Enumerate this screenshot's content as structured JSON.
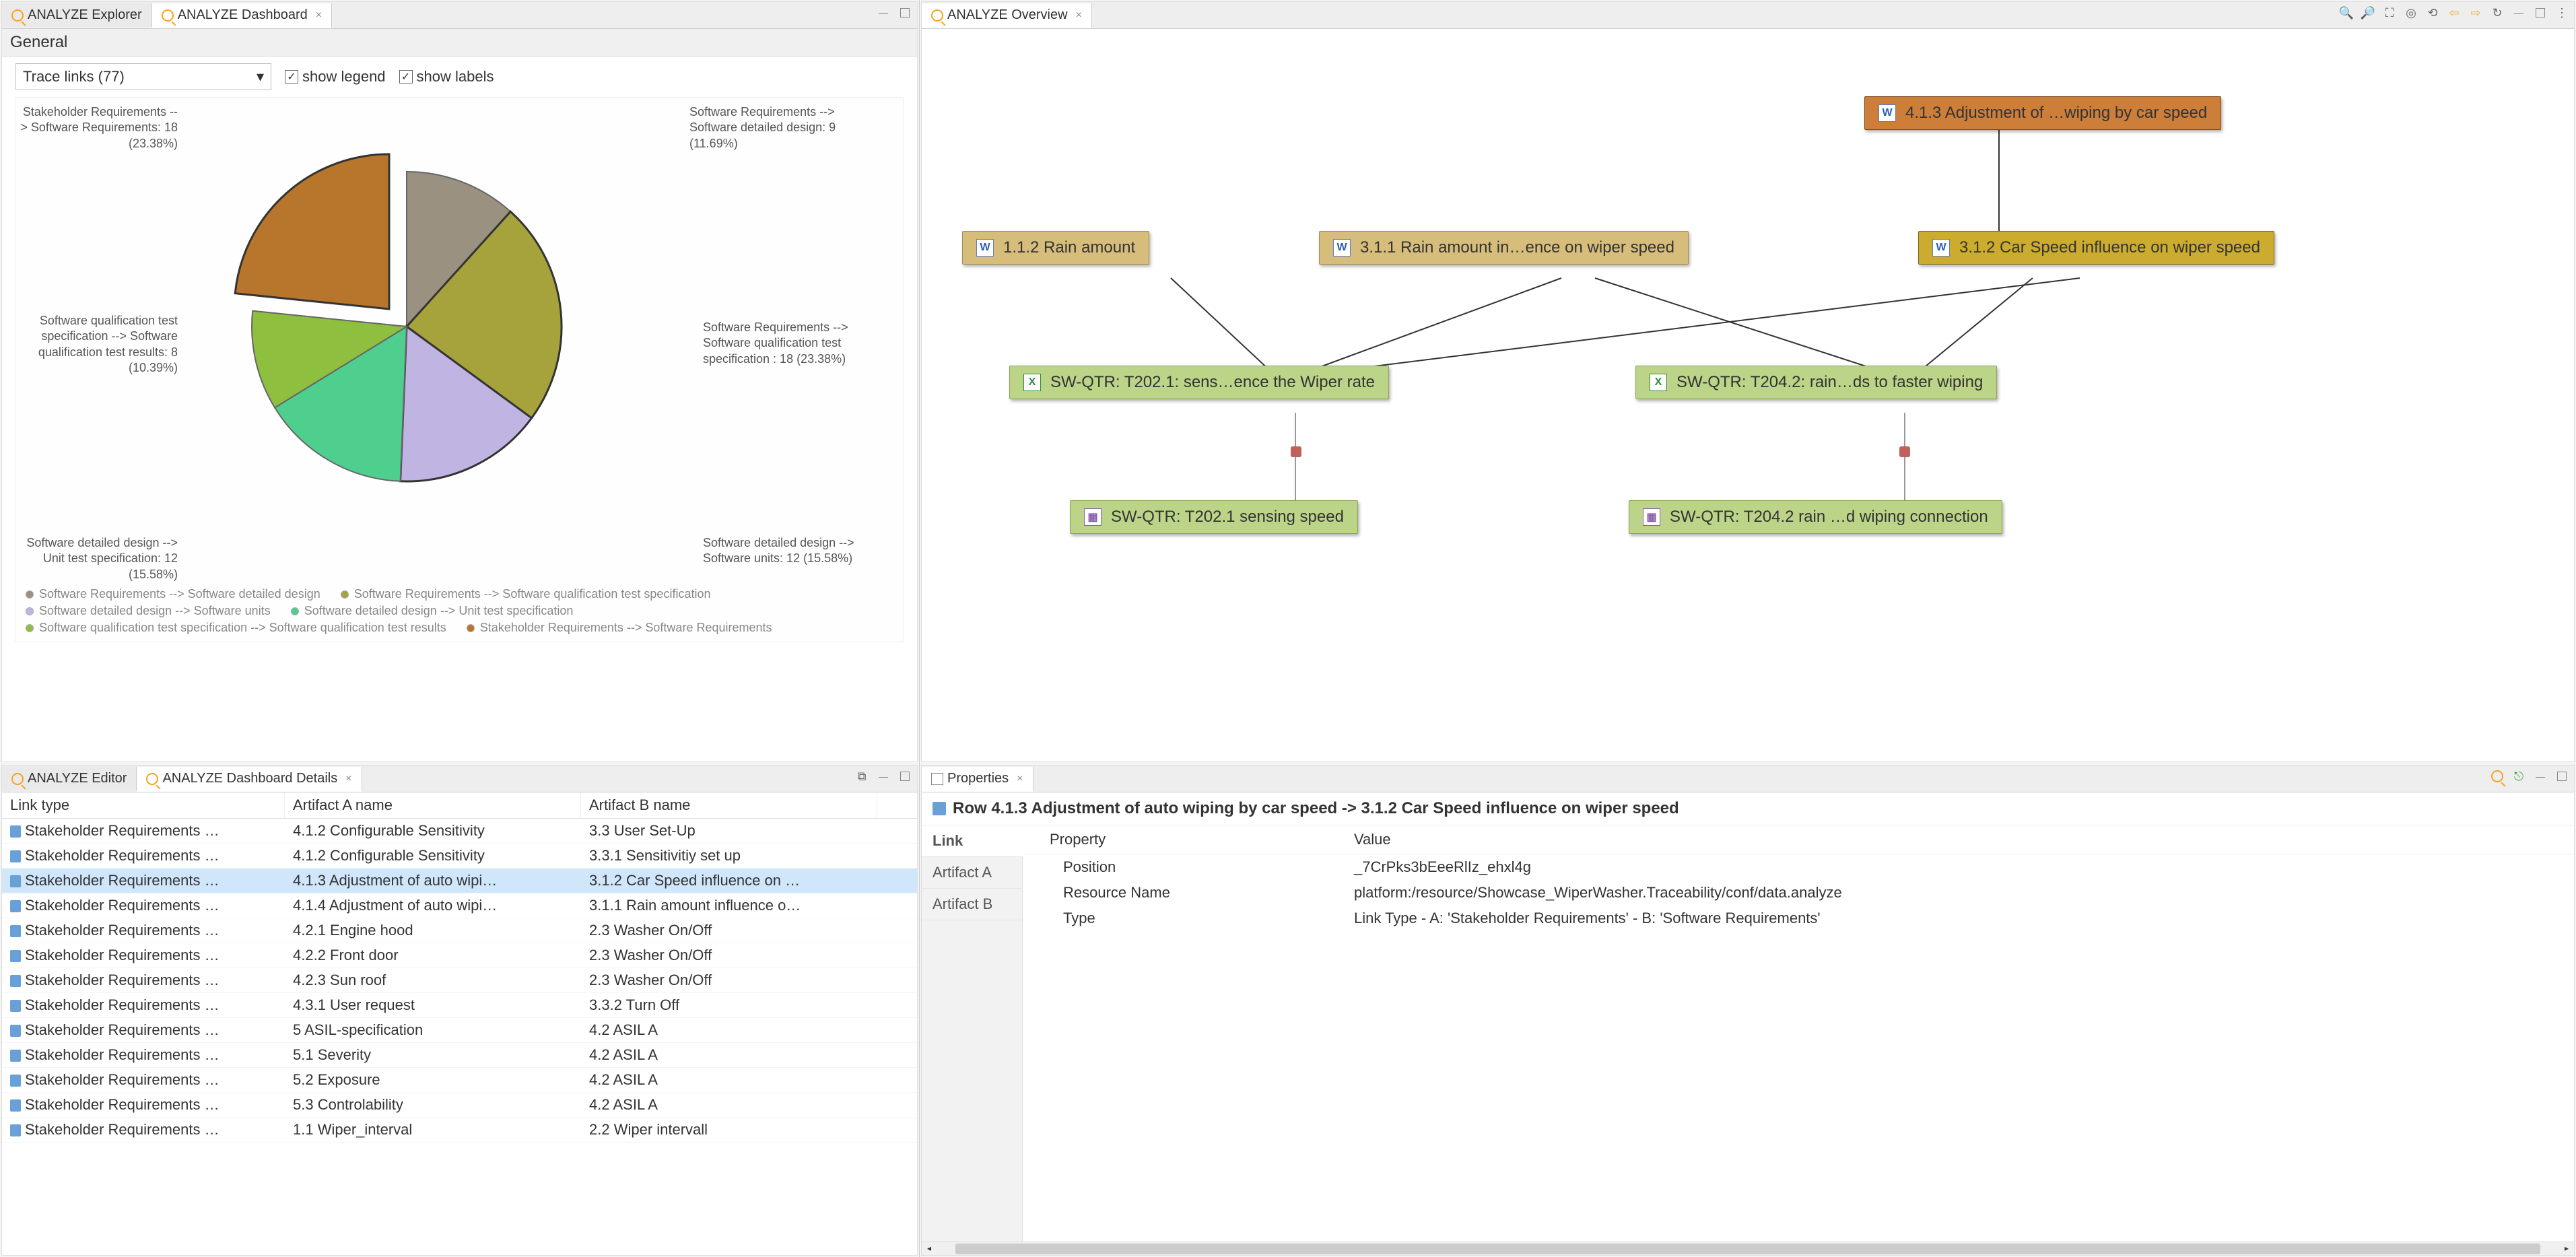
{
  "tabs": {
    "explorer": "ANALYZE Explorer",
    "dashboard": "ANALYZE Dashboard",
    "editor": "ANALYZE Editor",
    "dashboard_details": "ANALYZE Dashboard Details",
    "overview": "ANALYZE Overview",
    "properties": "Properties"
  },
  "dashboard": {
    "section": "General",
    "dropdown": "Trace links (77)",
    "show_legend": "show legend",
    "show_labels": "show labels",
    "pie_labels": {
      "sr_sdd": "Software Requirements --> Software detailed design: 9 (11.69%)",
      "sr_sqts": "Software Requirements --> Software qualification test specification : 18 (23.38%)",
      "sdd_su": "Software detailed design --> Software units: 12 (15.58%)",
      "sdd_uts": "Software detailed design --> Unit test specification: 12 (15.58%)",
      "sqts_sqtr": "Software qualification test specification  --> Software qualification test results: 8 (10.39%)",
      "shr_sr": "Stakeholder Requirements --> Software Requirements: 18 (23.38%)"
    },
    "legend": [
      {
        "label": "Software Requirements --> Software detailed design",
        "color": "#9a9180"
      },
      {
        "label": "Software Requirements --> Software qualification test specification",
        "color": "#a6a33c"
      },
      {
        "label": "Software detailed design --> Software units",
        "color": "#c0b4e2"
      },
      {
        "label": "Software detailed design --> Unit test specification",
        "color": "#4ecf8e"
      },
      {
        "label": "Software qualification test specification  --> Software qualification test results",
        "color": "#8fbf3e"
      },
      {
        "label": "Stakeholder Requirements --> Software Requirements",
        "color": "#b7762b"
      }
    ]
  },
  "chart_data": {
    "type": "pie",
    "title": "Trace links (77)",
    "series": [
      {
        "name": "Software Requirements --> Software detailed design",
        "value": 9,
        "percent": 11.69,
        "color": "#9a9180"
      },
      {
        "name": "Software Requirements --> Software qualification test specification",
        "value": 18,
        "percent": 23.38,
        "color": "#a6a33c"
      },
      {
        "name": "Software detailed design --> Software units",
        "value": 12,
        "percent": 15.58,
        "color": "#c0b4e2"
      },
      {
        "name": "Software detailed design --> Unit test specification",
        "value": 12,
        "percent": 15.58,
        "color": "#4ecf8e"
      },
      {
        "name": "Software qualification test specification  --> Software qualification test results",
        "value": 8,
        "percent": 10.39,
        "color": "#8fbf3e"
      },
      {
        "name": "Stakeholder Requirements --> Software Requirements",
        "value": 18,
        "percent": 23.38,
        "color": "#b7762b",
        "exploded": true
      }
    ]
  },
  "details": {
    "columns": {
      "link": "Link type",
      "a": "Artifact A name",
      "b": "Artifact B name"
    },
    "rows": [
      {
        "link": "Stakeholder Requirements …",
        "a": "4.1.2 Configurable Sensitivity",
        "b": "3.3 User Set-Up"
      },
      {
        "link": "Stakeholder Requirements …",
        "a": "4.1.2 Configurable Sensitivity",
        "b": "3.3.1 Sensitivitiy set up"
      },
      {
        "link": "Stakeholder Requirements …",
        "a": "4.1.3 Adjustment of auto wipi…",
        "b": "3.1.2 Car Speed influence on …",
        "selected": true
      },
      {
        "link": "Stakeholder Requirements …",
        "a": "4.1.4 Adjustment of auto wipi…",
        "b": "3.1.1 Rain amount influence o…"
      },
      {
        "link": "Stakeholder Requirements …",
        "a": "4.2.1 Engine hood",
        "b": "2.3 Washer On/Off"
      },
      {
        "link": "Stakeholder Requirements …",
        "a": "4.2.2 Front door",
        "b": "2.3 Washer On/Off"
      },
      {
        "link": "Stakeholder Requirements …",
        "a": "4.2.3 Sun roof",
        "b": "2.3 Washer On/Off"
      },
      {
        "link": "Stakeholder Requirements …",
        "a": "4.3.1 User request",
        "b": "3.3.2 Turn Off"
      },
      {
        "link": "Stakeholder Requirements …",
        "a": "5 ASIL-specification",
        "b": "4.2 ASIL A"
      },
      {
        "link": "Stakeholder Requirements …",
        "a": "5.1 Severity",
        "b": "4.2 ASIL A"
      },
      {
        "link": "Stakeholder Requirements …",
        "a": "5.2 Exposure",
        "b": "4.2 ASIL A"
      },
      {
        "link": "Stakeholder Requirements …",
        "a": "5.3 Controlability",
        "b": "4.2 ASIL A"
      },
      {
        "link": "Stakeholder Requirements …",
        "a": "1.1 Wiper_interval",
        "b": "2.2 Wiper intervall"
      }
    ]
  },
  "overview": {
    "nodes": {
      "n1": "4.1.3 Adjustment of …wiping by car speed",
      "n2": "1.1.2 Rain amount",
      "n3": "3.1.1 Rain amount in…ence on wiper speed",
      "n4": "3.1.2 Car Speed influence on wiper speed",
      "n5": "SW-QTR: T202.1: sens…ence the Wiper rate",
      "n6": "SW-QTR: T204.2: rain…ds to faster wiping",
      "n7": "SW-QTR: T202.1 sensing speed",
      "n8": "SW-QTR: T204.2 rain …d wiping connection"
    }
  },
  "properties": {
    "title": "Row 4.1.3 Adjustment of auto wiping by car speed -> 3.1.2 Car Speed influence on wiper speed",
    "tabs": {
      "link": "Link",
      "a": "Artifact A",
      "b": "Artifact B"
    },
    "head": {
      "prop": "Property",
      "val": "Value"
    },
    "rows": [
      {
        "p": "Position",
        "v": "_7CrPks3bEeeRlIz_ehxl4g"
      },
      {
        "p": "Resource Name",
        "v": "platform:/resource/Showcase_WiperWasher.Traceability/conf/data.analyze"
      },
      {
        "p": "Type",
        "v": "Link Type - A: 'Stakeholder Requirements' - B: 'Software Requirements'"
      }
    ]
  }
}
